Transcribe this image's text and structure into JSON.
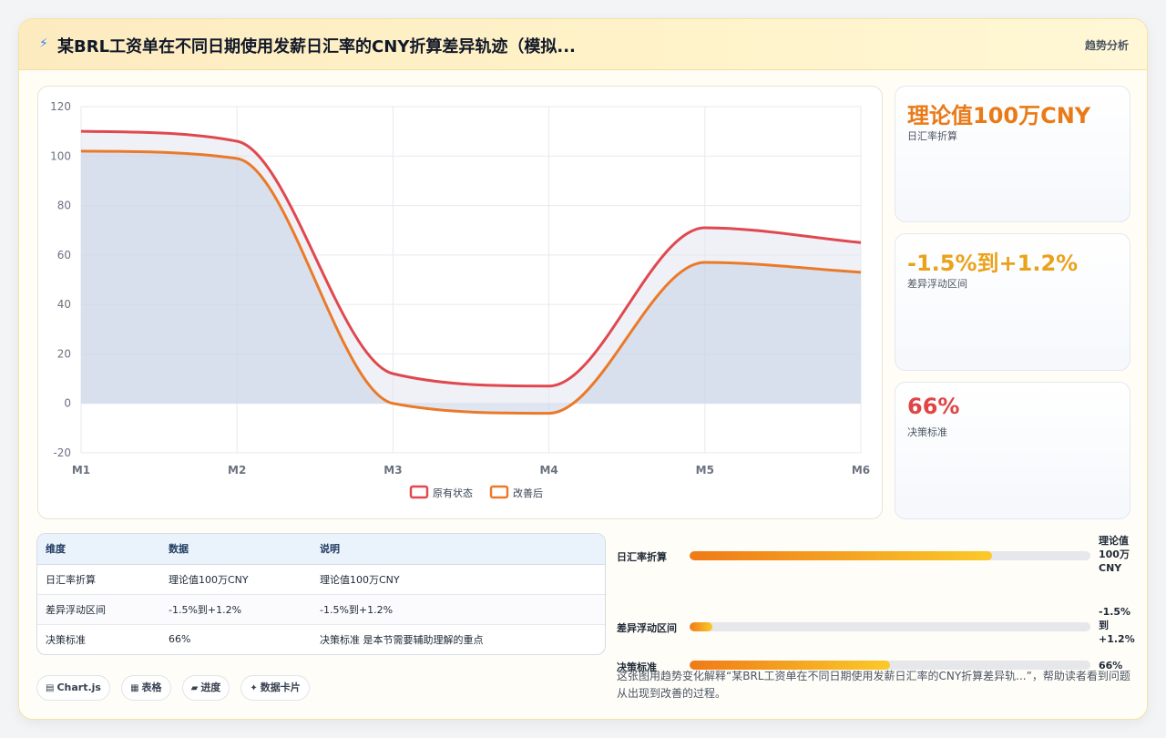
{
  "header": {
    "title": "某BRL工资单在不同日期使用发薪日汇率的CNY折算差异轨迹（模拟...",
    "tag": "趋势分析",
    "icon": "bolt-icon"
  },
  "chart_data": {
    "type": "line",
    "categories": [
      "M1",
      "M2",
      "M3",
      "M4",
      "M5",
      "M6"
    ],
    "series": [
      {
        "name": "原有状态",
        "values": [
          110,
          106,
          12,
          7,
          71,
          65
        ],
        "color": "#e0484f"
      },
      {
        "name": "改善后",
        "values": [
          102,
          99,
          0,
          -4,
          57,
          53
        ],
        "color": "#ea7a2a"
      }
    ],
    "ylim": [
      -20,
      120
    ],
    "yticks": [
      120,
      100,
      80,
      60,
      40,
      20,
      0,
      -20
    ],
    "grid": true,
    "legend": "bottom"
  },
  "stats": [
    {
      "value": "理论值100万CNY",
      "label": "日汇率折算",
      "color": "#ea7a17"
    },
    {
      "value": "-1.5%到+1.2%",
      "label": "差异浮动区间",
      "color": "#eba21b"
    },
    {
      "value": "66%",
      "label": "决策标准",
      "color": "#e04444"
    }
  ],
  "table": {
    "headers": [
      "维度",
      "数据",
      "说明"
    ],
    "rows": [
      [
        "日汇率折算",
        "理论值100万CNY",
        "理论值100万CNY"
      ],
      [
        "差异浮动区间",
        "-1.5%到+1.2%",
        "-1.5%到+1.2%"
      ],
      [
        "决策标准",
        "66%",
        "决策标准 是本节需要辅助理解的重点"
      ]
    ]
  },
  "progress": [
    {
      "label": "日汇率折算",
      "value_text": "理论值 100万 CNY",
      "fraction": 0.755
    },
    {
      "label": "差异浮动区间",
      "value_text": "-1.5% 到 +1.2%",
      "fraction": 0.057
    },
    {
      "label": "决策标准",
      "value_text": "66%",
      "fraction": 0.5
    }
  ],
  "caption": "这张图用趋势变化解释“某BRL工资单在不同日期使用发薪日汇率的CNY折算差异轨...”，帮助读者看到问题从出现到改善的过程。",
  "chips": [
    {
      "icon": "chart-icon",
      "glyph": "▤",
      "label": "Chart.js"
    },
    {
      "icon": "table-icon",
      "glyph": "▦",
      "label": "表格"
    },
    {
      "icon": "progress-icon",
      "glyph": "▰",
      "label": "进度"
    },
    {
      "icon": "card-icon",
      "glyph": "✦",
      "label": "数据卡片"
    }
  ]
}
